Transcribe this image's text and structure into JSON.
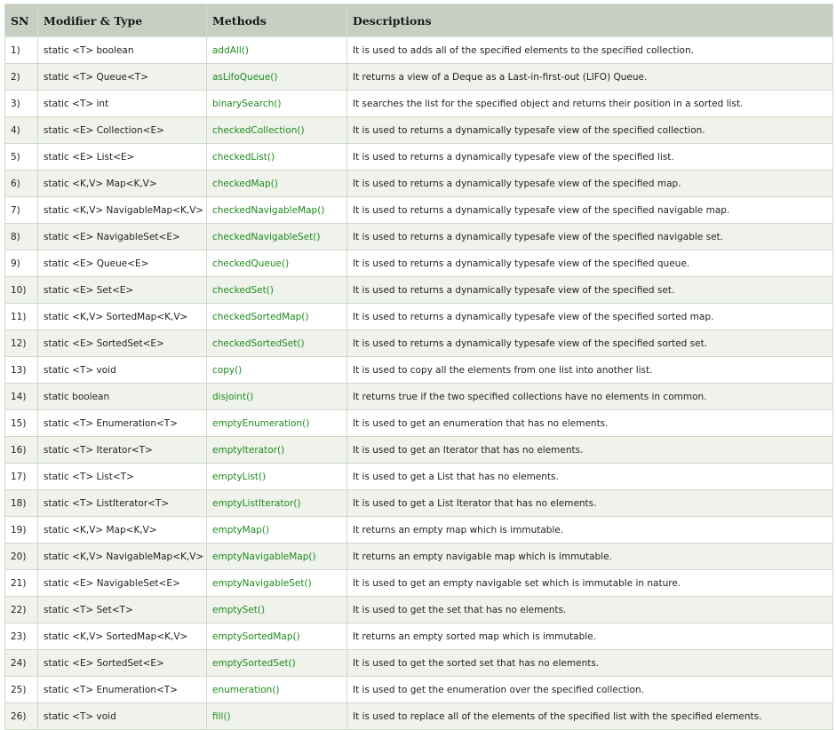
{
  "headers": [
    "SN",
    "Modifier & Type",
    "Methods",
    "Descriptions"
  ],
  "rows": [
    {
      "sn": "1)",
      "type": "static <T> boolean",
      "method": "addAll()",
      "desc": "It is used to adds all of the specified elements to the specified collection."
    },
    {
      "sn": "2)",
      "type": "static <T> Queue<T>",
      "method": "asLifoQueue()",
      "desc": "It returns a view of a Deque as a Last-in-first-out (LIFO) Queue."
    },
    {
      "sn": "3)",
      "type": "static <T> int",
      "method": "binarySearch()",
      "desc": "It searches the list for the specified object and returns their position in a sorted list."
    },
    {
      "sn": "4)",
      "type": "static <E> Collection<E>",
      "method": "checkedCollection()",
      "desc": "It is used to returns a dynamically typesafe view of the specified collection."
    },
    {
      "sn": "5)",
      "type": "static <E> List<E>",
      "method": "checkedList()",
      "desc": "It is used to returns a dynamically typesafe view of the specified list."
    },
    {
      "sn": "6)",
      "type": "static <K,V> Map<K,V>",
      "method": "checkedMap()",
      "desc": "It is used to returns a dynamically typesafe view of the specified map."
    },
    {
      "sn": "7)",
      "type": "static <K,V> NavigableMap<K,V>",
      "method": "checkedNavigableMap()",
      "desc": "It is used to returns a dynamically typesafe view of the specified navigable map."
    },
    {
      "sn": "8)",
      "type": "static <E> NavigableSet<E>",
      "method": "checkedNavigableSet()",
      "desc": "It is used to returns a dynamically typesafe view of the specified navigable set."
    },
    {
      "sn": "9)",
      "type": "static <E> Queue<E>",
      "method": "checkedQueue()",
      "desc": "It is used to returns a dynamically typesafe view of the specified queue."
    },
    {
      "sn": "10)",
      "type": "static <E> Set<E>",
      "method": "checkedSet()",
      "desc": "It is used to returns a dynamically typesafe view of the specified set."
    },
    {
      "sn": "11)",
      "type": "static <K,V> SortedMap<K,V>",
      "method": "checkedSortedMap()",
      "desc": "It is used to returns a dynamically typesafe view of the specified sorted map."
    },
    {
      "sn": "12)",
      "type": "static <E> SortedSet<E>",
      "method": "checkedSortedSet()",
      "desc": "It is used to returns a dynamically typesafe view of the specified sorted set."
    },
    {
      "sn": "13)",
      "type": "static <T> void",
      "method": "copy()",
      "desc": "It is used to copy all the elements from one list into another list."
    },
    {
      "sn": "14)",
      "type": "static boolean",
      "method": "disjoint()",
      "desc": "It returns true if the two specified collections have no elements in common."
    },
    {
      "sn": "15)",
      "type": "static <T> Enumeration<T>",
      "method": "emptyEnumeration()",
      "desc": "It is used to get an enumeration that has no elements."
    },
    {
      "sn": "16)",
      "type": "static <T> Iterator<T>",
      "method": "emptyIterator()",
      "desc": "It is used to get an Iterator that has no elements."
    },
    {
      "sn": "17)",
      "type": "static <T> List<T>",
      "method": "emptyList()",
      "desc": "It is used to get a List that has no elements."
    },
    {
      "sn": "18)",
      "type": "static <T> ListIterator<T>",
      "method": "emptyListIterator()",
      "desc": "It is used to get a List Iterator that has no elements."
    },
    {
      "sn": "19)",
      "type": "static <K,V> Map<K,V>",
      "method": "emptyMap()",
      "desc": "It returns an empty map which is immutable."
    },
    {
      "sn": "20)",
      "type": "static <K,V> NavigableMap<K,V>",
      "method": "emptyNavigableMap()",
      "desc": "It returns an empty navigable map which is immutable."
    },
    {
      "sn": "21)",
      "type": "static <E> NavigableSet<E>",
      "method": "emptyNavigableSet()",
      "desc": "It is used to get an empty navigable set which is immutable in nature."
    },
    {
      "sn": "22)",
      "type": "static <T> Set<T>",
      "method": "emptySet()",
      "desc": "It is used to get the set that has no elements."
    },
    {
      "sn": "23)",
      "type": "static <K,V> SortedMap<K,V>",
      "method": "emptySortedMap()",
      "desc": "It returns an empty sorted map which is immutable."
    },
    {
      "sn": "24)",
      "type": "static <E> SortedSet<E>",
      "method": "emptySortedSet()",
      "desc": "It is used to get the sorted set that has no elements."
    },
    {
      "sn": "25)",
      "type": "static <T> Enumeration<T>",
      "method": "enumeration()",
      "desc": "It is used to get the enumeration over the specified collection."
    },
    {
      "sn": "26)",
      "type": "static <T> void",
      "method": "fill()",
      "desc": "It is used to replace all of the elements of the specified list with the specified elements."
    }
  ],
  "colors": {
    "header_bg": "#c7cfc3",
    "row_alt_bg": "#eff3ec",
    "method_link": "#1e8a1e",
    "border": "#cfd8c9"
  }
}
